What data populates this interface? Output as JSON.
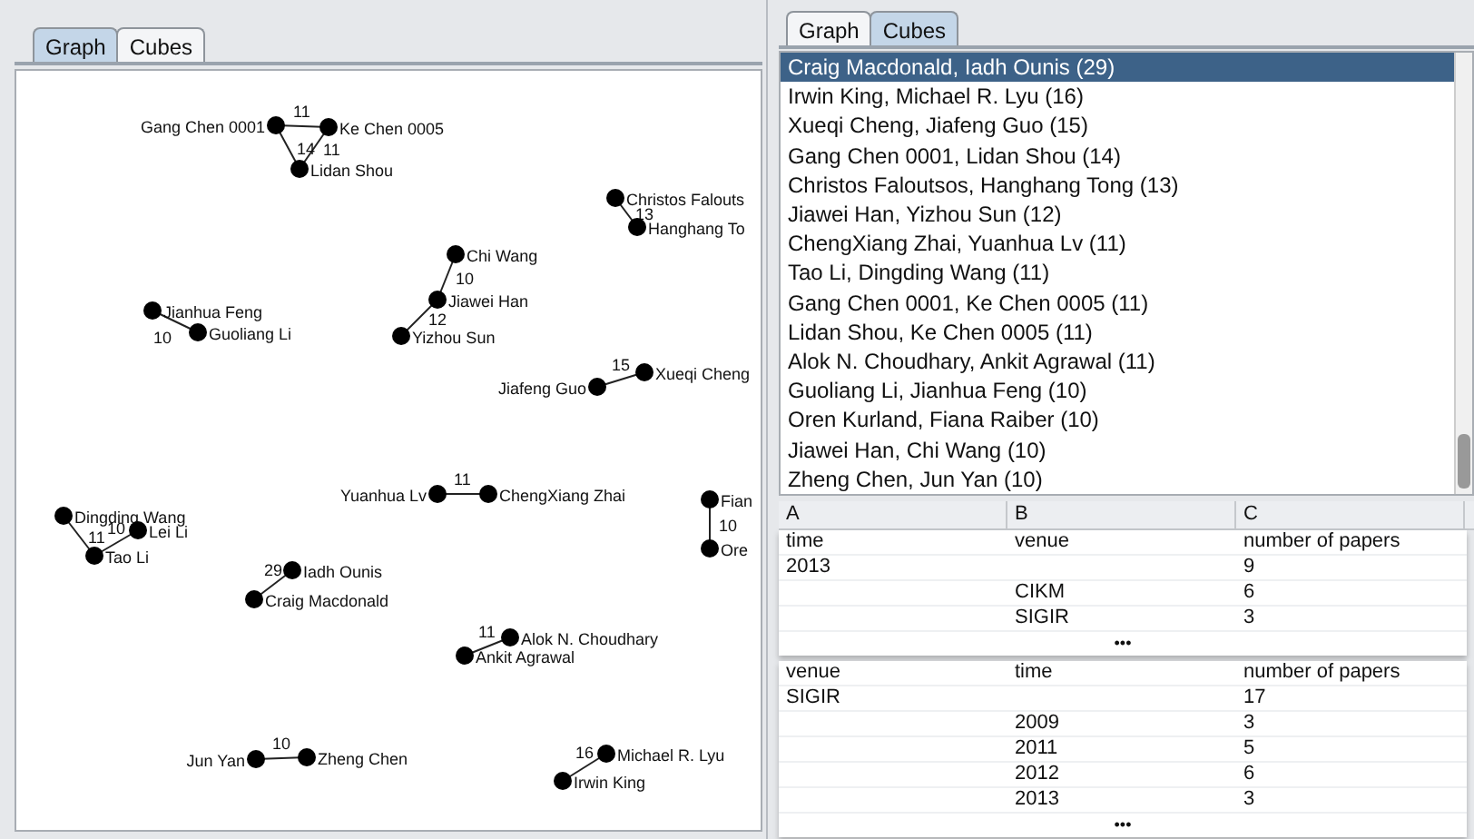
{
  "left_panel": {
    "tabs": [
      {
        "label": "Graph",
        "selected": true
      },
      {
        "label": "Cubes",
        "selected": false
      }
    ],
    "graph": {
      "nodes": [
        {
          "label": "Gang Chen 0001"
        },
        {
          "label": "Ke Chen 0005"
        },
        {
          "label": "Lidan Shou"
        },
        {
          "label": "Christos Falouts"
        },
        {
          "label": "Hanghang To"
        },
        {
          "label": "Chi Wang"
        },
        {
          "label": "Jiawei Han"
        },
        {
          "label": "Yizhou Sun"
        },
        {
          "label": "Jianhua Feng"
        },
        {
          "label": "Guoliang Li"
        },
        {
          "label": "Jiafeng Guo"
        },
        {
          "label": "Xueqi Cheng"
        },
        {
          "label": "Yuanhua Lv"
        },
        {
          "label": "ChengXiang Zhai"
        },
        {
          "label": "Fian"
        },
        {
          "label": "Ore"
        },
        {
          "label": "Dingding Wang"
        },
        {
          "label": "Lei Li"
        },
        {
          "label": "Tao Li"
        },
        {
          "label": "Iadh Ounis"
        },
        {
          "label": "Craig Macdonald"
        },
        {
          "label": "Alok N. Choudhary"
        },
        {
          "label": "Ankit Agrawal"
        },
        {
          "label": "Jun Yan"
        },
        {
          "label": "Zheng Chen"
        },
        {
          "label": "Michael R. Lyu"
        },
        {
          "label": "Irwin King"
        }
      ],
      "edges": [
        {
          "label": "11"
        },
        {
          "label": "14"
        },
        {
          "label": "11"
        },
        {
          "label": "13"
        },
        {
          "label": "10"
        },
        {
          "label": "12"
        },
        {
          "label": "10"
        },
        {
          "label": "15"
        },
        {
          "label": "11"
        },
        {
          "label": "10"
        },
        {
          "label": "11"
        },
        {
          "label": "10"
        },
        {
          "label": "29"
        },
        {
          "label": "11"
        },
        {
          "label": "10"
        },
        {
          "label": "16"
        }
      ]
    }
  },
  "right_panel": {
    "tabs": [
      {
        "label": "Graph",
        "selected": false
      },
      {
        "label": "Cubes",
        "selected": true
      }
    ],
    "pairs": [
      {
        "label": "Craig Macdonald, Iadh Ounis (29)",
        "selected": true
      },
      {
        "label": "Irwin King, Michael R. Lyu (16)",
        "selected": false
      },
      {
        "label": "Xueqi Cheng, Jiafeng Guo (15)",
        "selected": false
      },
      {
        "label": "Gang Chen 0001, Lidan Shou (14)",
        "selected": false
      },
      {
        "label": "Christos Faloutsos, Hanghang Tong (13)",
        "selected": false
      },
      {
        "label": "Jiawei Han, Yizhou Sun (12)",
        "selected": false
      },
      {
        "label": "ChengXiang Zhai, Yuanhua Lv (11)",
        "selected": false
      },
      {
        "label": "Tao Li, Dingding Wang (11)",
        "selected": false
      },
      {
        "label": "Gang Chen 0001, Ke Chen 0005 (11)",
        "selected": false
      },
      {
        "label": "Lidan Shou, Ke Chen 0005 (11)",
        "selected": false
      },
      {
        "label": "Alok N. Choudhary, Ankit Agrawal (11)",
        "selected": false
      },
      {
        "label": "Guoliang Li, Jianhua Feng (10)",
        "selected": false
      },
      {
        "label": "Oren Kurland, Fiana Raiber (10)",
        "selected": false
      },
      {
        "label": "Jiawei Han, Chi Wang (10)",
        "selected": false
      },
      {
        "label": "Zheng Chen, Jun Yan (10)",
        "selected": false
      }
    ],
    "table": {
      "columns": [
        "A",
        "B",
        "C"
      ],
      "groups": [
        {
          "rows": [
            [
              "time",
              "venue",
              "number of papers"
            ],
            [
              "2013",
              null,
              "9"
            ],
            [
              null,
              "CIKM",
              "6"
            ],
            [
              null,
              "SIGIR",
              "3"
            ]
          ],
          "more": "•••"
        },
        {
          "rows": [
            [
              "venue",
              "time",
              "number of papers"
            ],
            [
              "SIGIR",
              null,
              "17"
            ],
            [
              null,
              "2009",
              "3"
            ],
            [
              null,
              "2011",
              "5"
            ],
            [
              null,
              "2012",
              "6"
            ],
            [
              null,
              "2013",
              "3"
            ]
          ],
          "more": "•••"
        }
      ]
    }
  }
}
